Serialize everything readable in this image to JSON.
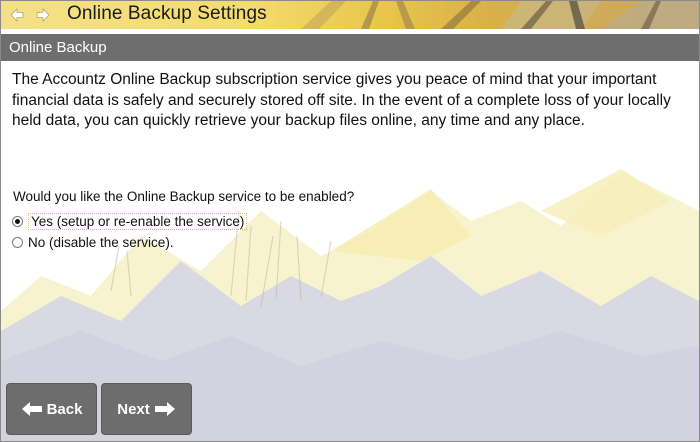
{
  "header": {
    "title": "Online Backup Settings",
    "back_icon": "arrow-left-icon",
    "forward_icon": "arrow-right-icon"
  },
  "section": {
    "title": "Online Backup"
  },
  "content": {
    "intro": "The Accountz Online Backup subscription service gives you peace of mind that your important financial data is safely and securely stored off site. In the event of a complete loss of your locally held data, you can quickly retrieve your backup files online, any time and any place.",
    "question": "Would you like the Online Backup service to be enabled?",
    "options": [
      {
        "label": "Yes (setup or re-enable the service)",
        "selected": true
      },
      {
        "label": "No (disable the service).",
        "selected": false
      }
    ]
  },
  "buttons": {
    "back_label": "Back",
    "next_label": "Next"
  },
  "colors": {
    "header_gold": "#f3dc6e",
    "section_grey": "#6e6e6e",
    "button_grey": "#6d6d6d",
    "mountain_grey": "#d6d6e3",
    "mountain_yellow": "#f7f1c6"
  }
}
